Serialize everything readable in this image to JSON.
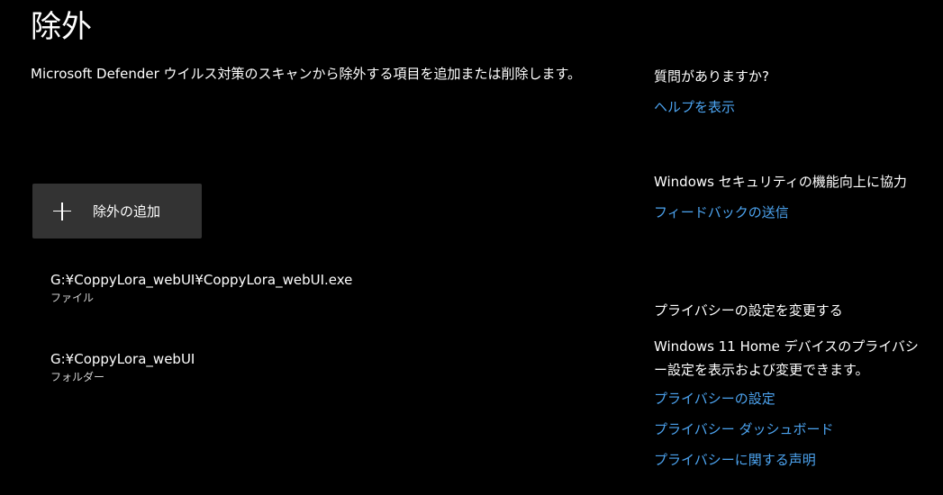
{
  "page": {
    "title": "除外",
    "description": "Microsoft Defender ウイルス対策のスキャンから除外する項目を追加または削除します。"
  },
  "add_exclusion": {
    "icon": "plus-icon",
    "label": "除外の追加"
  },
  "exclusions": [
    {
      "path": "G:¥CoppyLora_webUI¥CoppyLora_webUI.exe",
      "type": "ファイル"
    },
    {
      "path": "G:¥CoppyLora_webUI",
      "type": "フォルダー"
    }
  ],
  "sidebar": {
    "help": {
      "heading": "質問がありますか?",
      "link": "ヘルプを表示"
    },
    "feedback": {
      "heading": "Windows セキュリティの機能向上に協力",
      "link": "フィードバックの送信"
    },
    "privacy": {
      "heading": "プライバシーの設定を変更する",
      "text": "Windows 11 Home デバイスのプライバシー設定を表示および変更できます。",
      "links": [
        "プライバシーの設定",
        "プライバシー ダッシュボード",
        "プライバシーに関する声明"
      ]
    }
  },
  "colors": {
    "background": "#000000",
    "button": "#333333",
    "link": "#4ca3ef"
  }
}
